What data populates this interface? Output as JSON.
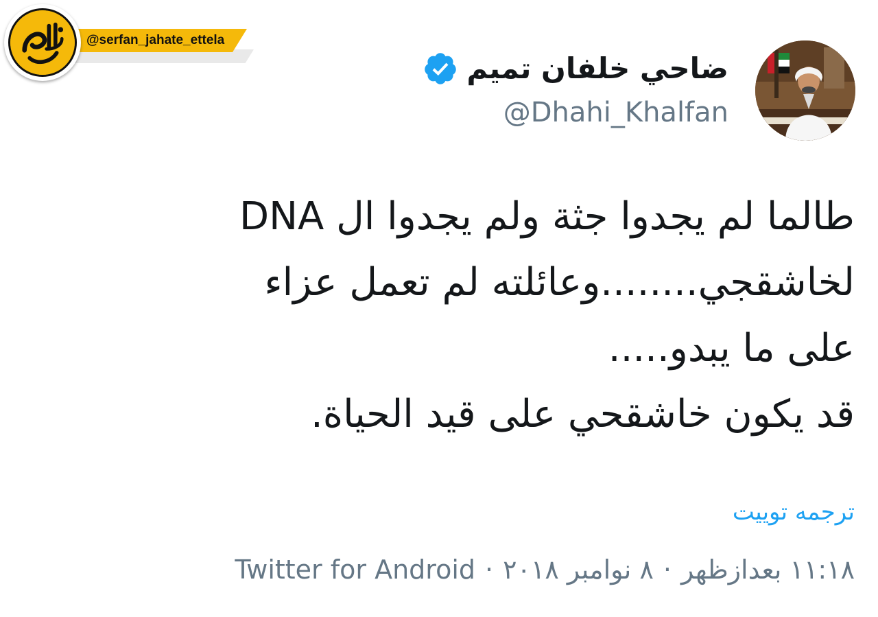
{
  "watermark": {
    "handle": "@serfan_jahate_ettela",
    "logo_text": "اطلاع جهت صرفا"
  },
  "tweet": {
    "display_name": "ضاحي خلفان تميم",
    "handle": "@Dhahi_Khalfan",
    "verified": true,
    "body_lines": [
      "طالما لم يجدوا جثة ولم يجدوا ال DNA",
      "لخاشقجي........وعائلته لم تعمل عزاء",
      "على ما يبدو.....",
      "قد يكون خاشقحي على قيد الحياة."
    ],
    "translate_label": "ترجمه توییت",
    "time": "۱۱:۱۸ بعدازظهر",
    "date": "۸ نوامبر ۲۰۱۸",
    "separator": "·",
    "source": "Twitter for Android"
  },
  "colors": {
    "text": "#14171a",
    "secondary": "#657786",
    "link": "#1da1f2",
    "verified": "#1da1f2",
    "watermark": "#f5b90a"
  },
  "icons": {
    "verified": "verified-badge-icon",
    "avatar": "profile-photo"
  }
}
